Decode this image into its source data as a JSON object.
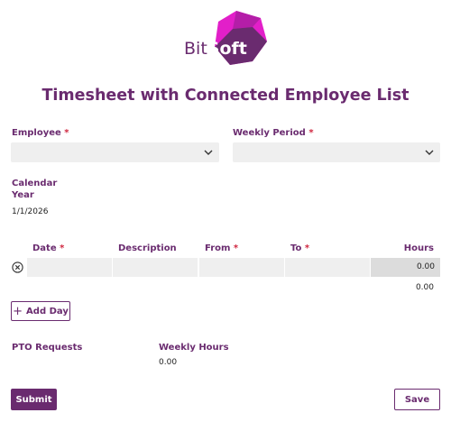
{
  "brand": {
    "name_part1": "Bit",
    "name_part2": "Soft",
    "color_primary": "#6a2b6f",
    "color_accent": "#e21fc9"
  },
  "page": {
    "title": "Timesheet with Connected Employee List"
  },
  "form": {
    "employee": {
      "label": "Employee",
      "required": "*",
      "value": ""
    },
    "weekly_period": {
      "label": "Weekly Period",
      "required": "*",
      "value": ""
    },
    "calendar_year": {
      "label_line1": "Calendar",
      "label_line2": "Year",
      "value": "1/1/2026"
    }
  },
  "days_table": {
    "columns": {
      "date": {
        "label": "Date",
        "required": "*"
      },
      "description": {
        "label": "Description"
      },
      "from": {
        "label": "From",
        "required": "*"
      },
      "to": {
        "label": "To",
        "required": "*"
      },
      "hours": {
        "label": "Hours"
      }
    },
    "rows": [
      {
        "date": "",
        "description": "",
        "from": "",
        "to": "",
        "hours": "0.00"
      }
    ],
    "total_hours": "0.00",
    "add_day_label": "Add Day"
  },
  "summary": {
    "pto_label": "PTO Requests",
    "weekly_hours_label": "Weekly Hours",
    "weekly_hours_value": "0.00"
  },
  "actions": {
    "submit_label": "Submit",
    "save_label": "Save"
  },
  "icons": {
    "dropdown": "chevron-down-icon",
    "remove_row": "remove-circle-icon",
    "add": "plus-icon"
  }
}
